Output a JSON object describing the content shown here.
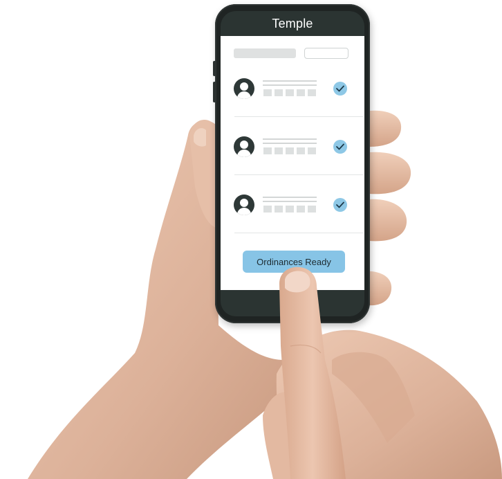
{
  "app": {
    "title": "Temple"
  },
  "header": {
    "search_placeholder": "",
    "filter_label": ""
  },
  "list": {
    "items": [
      {
        "avatar_icon": "person-icon",
        "checked": true,
        "status_icon": "checkmark-icon"
      },
      {
        "avatar_icon": "person-icon",
        "checked": true,
        "status_icon": "checkmark-icon"
      },
      {
        "avatar_icon": "person-icon",
        "checked": true,
        "status_icon": "checkmark-icon"
      }
    ]
  },
  "actions": {
    "primary_label": "Ordinances Ready"
  },
  "colors": {
    "header_bg": "#2b3432",
    "accent": "#87c4e6",
    "check_bg": "#8ec8e6",
    "avatar_bg": "#2e3837",
    "skin": "#e2b9a2"
  }
}
